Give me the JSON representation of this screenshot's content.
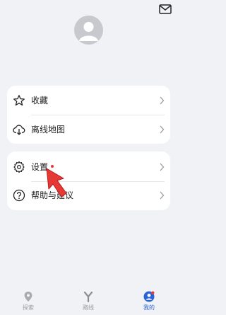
{
  "menu": {
    "card1": [
      {
        "label": "收藏",
        "icon": "star-icon"
      },
      {
        "label": "离线地图",
        "icon": "cloud-download-icon"
      }
    ],
    "card2": [
      {
        "label": "设置",
        "icon": "gear-icon"
      },
      {
        "label": "帮助与建议",
        "icon": "help-circle-icon"
      }
    ]
  },
  "tabs": [
    {
      "label": "探索",
      "icon": "location-pin-icon"
    },
    {
      "label": "路线",
      "icon": "route-icon"
    },
    {
      "label": "我的",
      "icon": "profile-icon"
    }
  ],
  "colors": {
    "accent": "#2a63d8",
    "badge": "#e53935",
    "arrow": "#e53935"
  }
}
